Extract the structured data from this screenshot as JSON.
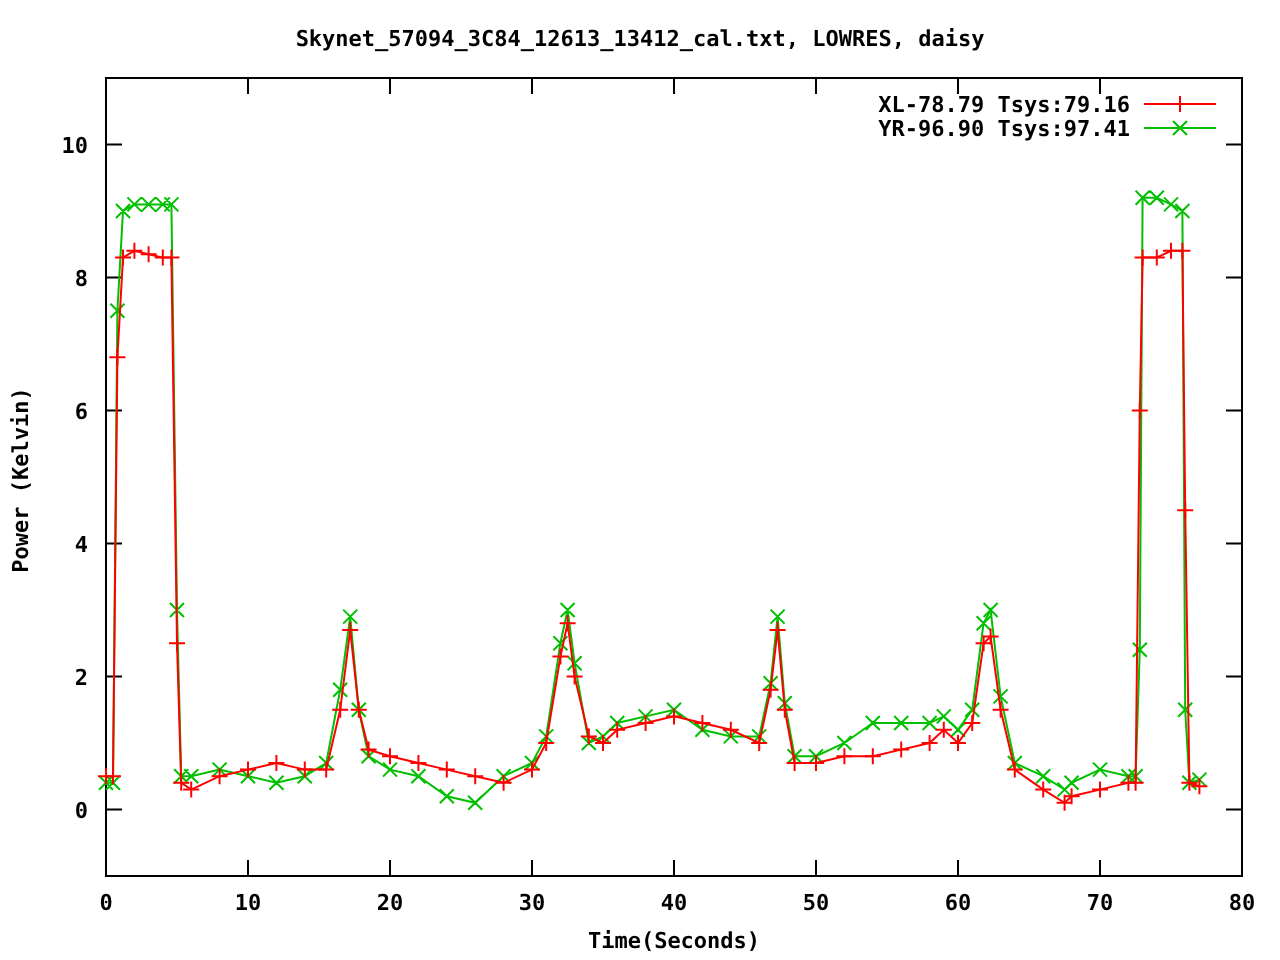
{
  "chart_data": {
    "type": "line",
    "title": "Skynet_57094_3C84_12613_13412_cal.txt, LOWRES, daisy",
    "xlabel": "Time(Seconds)",
    "ylabel": "Power (Kelvin)",
    "x": [
      0,
      0.5,
      0.8,
      1.2,
      2,
      3,
      4,
      4.6,
      5,
      5.3,
      6,
      8,
      10,
      12,
      14,
      15.5,
      16.5,
      17.2,
      17.8,
      18.5,
      20,
      22,
      24,
      26,
      28,
      30,
      31,
      32,
      32.5,
      33,
      34,
      35,
      36,
      38,
      40,
      42,
      44,
      46,
      46.8,
      47.3,
      47.8,
      48.5,
      50,
      52,
      54,
      56,
      58,
      59,
      60,
      61,
      61.8,
      62.3,
      63,
      64,
      66,
      67.5,
      68,
      70,
      72,
      72.5,
      72.8,
      73,
      74,
      75,
      75.8,
      76,
      76.3,
      77
    ],
    "series": [
      {
        "name": "XL-78.79 Tsys:79.16",
        "color": "#ff0000",
        "marker": "plus",
        "values": [
          0.5,
          0.5,
          6.8,
          8.3,
          8.4,
          8.35,
          8.3,
          8.3,
          2.5,
          0.4,
          0.3,
          0.5,
          0.6,
          0.7,
          0.6,
          0.6,
          1.5,
          2.7,
          1.5,
          0.9,
          0.8,
          0.7,
          0.6,
          0.5,
          0.4,
          0.6,
          1.0,
          2.3,
          2.8,
          2.0,
          1.1,
          1.0,
          1.2,
          1.3,
          1.4,
          1.3,
          1.2,
          1.0,
          1.8,
          2.7,
          1.5,
          0.7,
          0.7,
          0.8,
          0.8,
          0.9,
          1.0,
          1.2,
          1.0,
          1.3,
          2.5,
          2.6,
          1.5,
          0.6,
          0.3,
          0.1,
          0.2,
          0.3,
          0.4,
          0.4,
          6.0,
          8.3,
          8.3,
          8.4,
          8.4,
          4.5,
          0.4,
          0.35
        ]
      },
      {
        "name": "YR-96.90 Tsys:97.41",
        "color": "#00c000",
        "marker": "x",
        "values": [
          0.4,
          0.4,
          7.5,
          9.0,
          9.1,
          9.1,
          9.1,
          9.1,
          3.0,
          0.5,
          0.5,
          0.6,
          0.5,
          0.4,
          0.5,
          0.7,
          1.8,
          2.9,
          1.5,
          0.8,
          0.6,
          0.5,
          0.2,
          0.1,
          0.5,
          0.7,
          1.1,
          2.5,
          3.0,
          2.2,
          1.0,
          1.1,
          1.3,
          1.4,
          1.5,
          1.2,
          1.1,
          1.1,
          1.9,
          2.9,
          1.6,
          0.8,
          0.8,
          1.0,
          1.3,
          1.3,
          1.3,
          1.4,
          1.2,
          1.5,
          2.8,
          3.0,
          1.7,
          0.7,
          0.5,
          0.3,
          0.4,
          0.6,
          0.5,
          0.5,
          2.4,
          9.2,
          9.2,
          9.1,
          9.0,
          1.5,
          0.4,
          0.45
        ]
      }
    ],
    "legend": true,
    "xlim": [
      0,
      80
    ],
    "ylim": [
      -1,
      11
    ],
    "xticks": [
      0,
      10,
      20,
      30,
      40,
      50,
      60,
      70,
      80
    ],
    "yticks": [
      0,
      2,
      4,
      6,
      8,
      10
    ]
  }
}
